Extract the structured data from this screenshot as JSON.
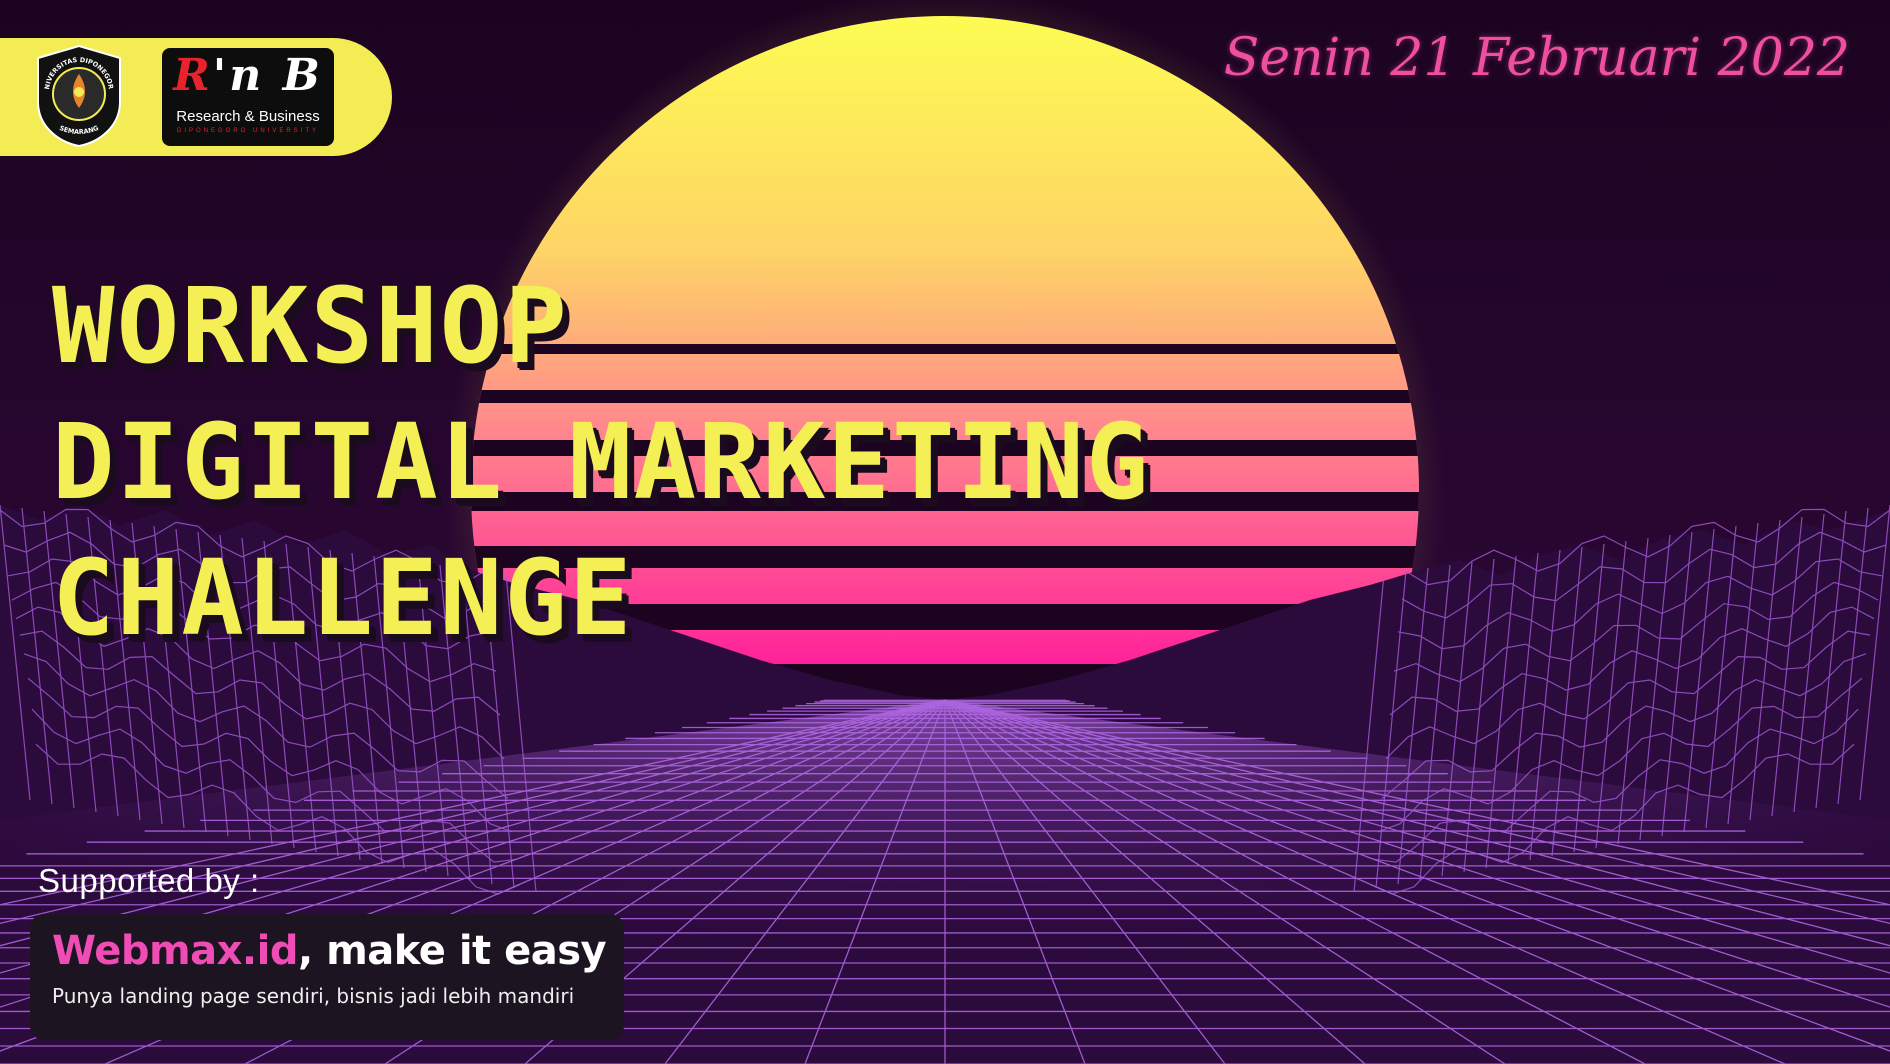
{
  "header": {
    "university_logo_text": {
      "top": "UNIVERSITAS DIPONEGORO",
      "bottom": "SEMARANG"
    },
    "partner_logo": {
      "mark_r": "R",
      "mark_rest": "'n B",
      "name": "Research & Business",
      "subname": "DIPONEGORO UNIVERSITY"
    },
    "date": "Senin 21 Februari 2022"
  },
  "title": {
    "line1": "WORKSHOP",
    "line2": "DIGITAL MARKETING",
    "line3": "CHALLENGE"
  },
  "sponsor": {
    "label": "Supported by :",
    "name": "Webmax.id",
    "slogan": ", make it easy",
    "tagline": "Punya landing page sendiri, bisnis jadi lebih mandiri"
  },
  "colors": {
    "background": "#1a0521",
    "title": "#f3ef55",
    "date": "#ef4fa0",
    "sponsor_accent": "#f04cb5",
    "grid": "#b46ae8",
    "sun_top": "#fdfd52",
    "sun_bottom": "#ff129c",
    "logo_bar": "#f4ec55"
  }
}
